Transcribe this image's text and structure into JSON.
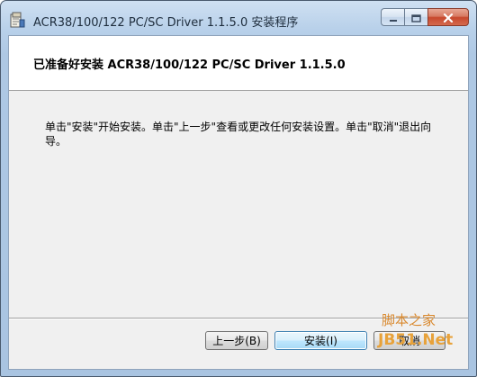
{
  "window": {
    "title": "ACR38/100/122 PC/SC Driver 1.1.5.0 安装程序"
  },
  "banner": {
    "title": "已准备好安装 ACR38/100/122 PC/SC Driver 1.1.5.0"
  },
  "body": {
    "instructions": "单击\"安装\"开始安装。单击\"上一步\"查看或更改任何安装设置。单击\"取消\"退出向导。"
  },
  "buttons": {
    "back": "上一步(B)",
    "install": "安装(I)",
    "cancel": "取消"
  },
  "watermark": {
    "line1": "脚本之家",
    "line2": "JB51.Net"
  },
  "icons": {
    "app": "installer-icon",
    "minimize": "minimize-icon",
    "maximize": "maximize-icon",
    "close": "close-icon"
  }
}
